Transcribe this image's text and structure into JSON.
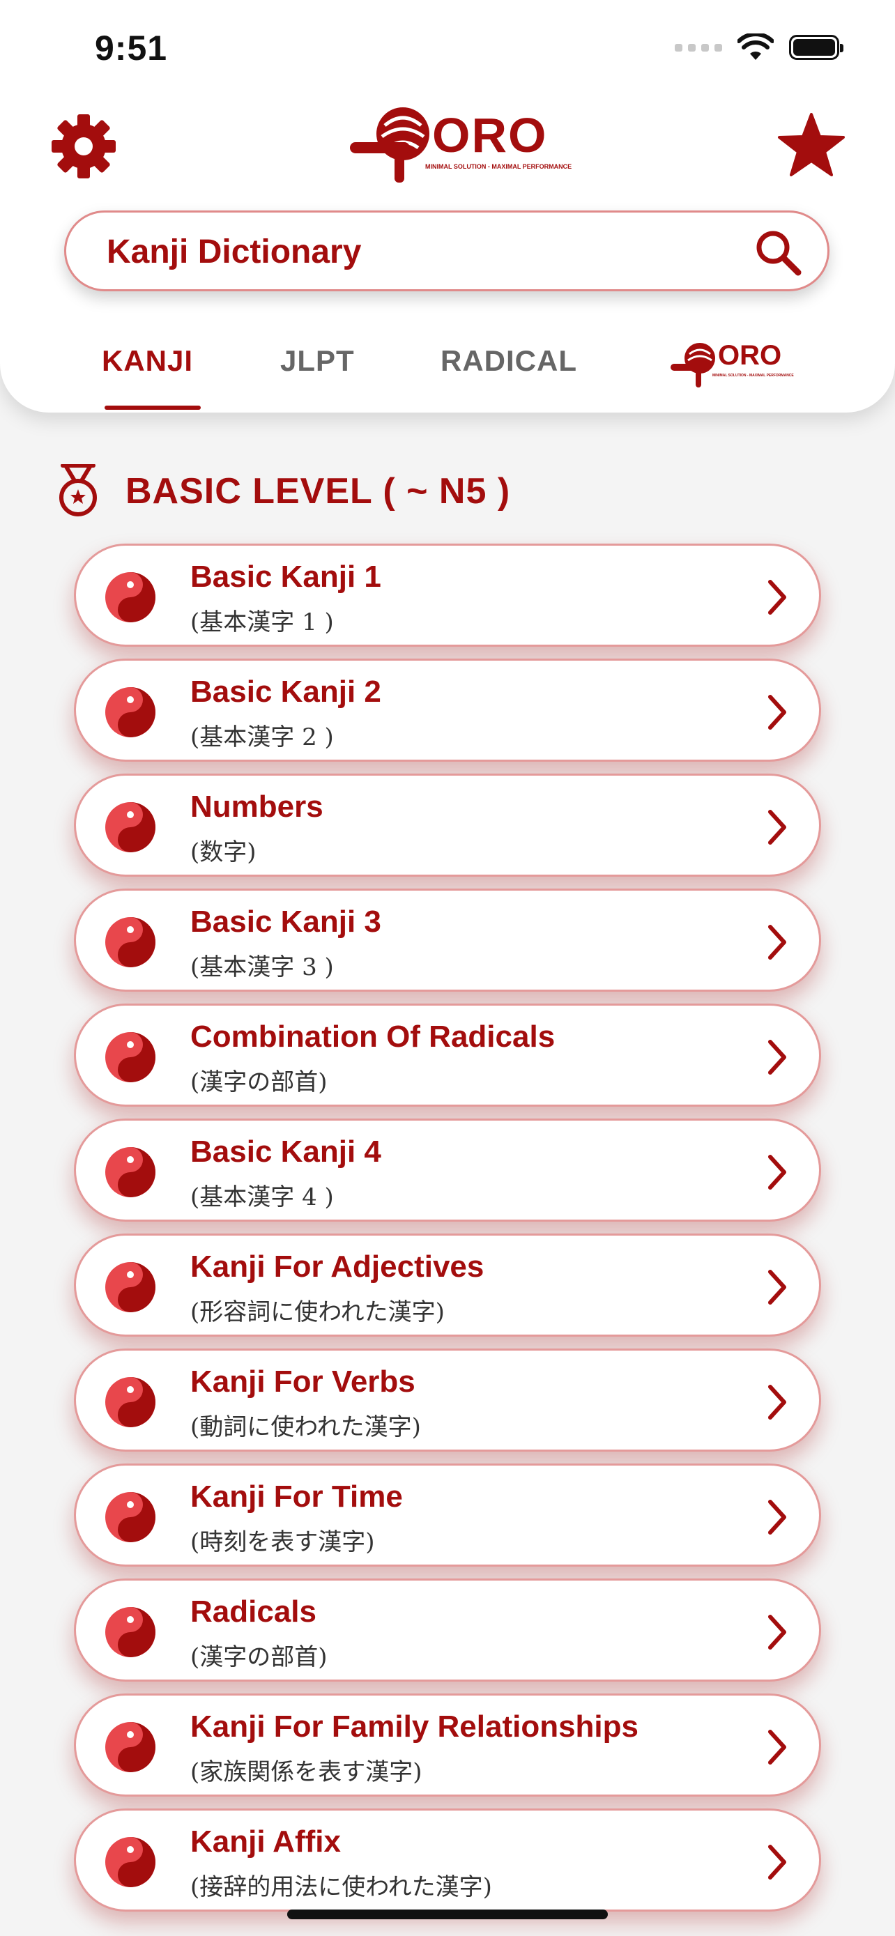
{
  "status": {
    "time": "9:51"
  },
  "brand": {
    "name": "ORO",
    "tagline": "MINIMAL SOLUTION - MAXIMAL PERFORMANCE",
    "color": "#a30d0d"
  },
  "icons": {
    "settings": "gear-icon",
    "favorites": "star-icon",
    "search": "search-icon",
    "section": "medal-icon",
    "item": "yin-yang-icon",
    "chevron": "chevron-right-icon"
  },
  "search": {
    "placeholder": "Kanji Dictionary",
    "value": ""
  },
  "tabs": [
    {
      "label": "KANJI",
      "active": true
    },
    {
      "label": "JLPT",
      "active": false
    },
    {
      "label": "RADICAL",
      "active": false
    }
  ],
  "section": {
    "title": "BASIC LEVEL ( ~ N5 )"
  },
  "items": [
    {
      "title": "Basic Kanji 1",
      "subtitle": "(基本漢字 1 )"
    },
    {
      "title": "Basic Kanji 2",
      "subtitle": "(基本漢字 2 )"
    },
    {
      "title": "Numbers",
      "subtitle": "(数字)"
    },
    {
      "title": "Basic Kanji 3",
      "subtitle": "(基本漢字 3 )"
    },
    {
      "title": "Combination Of Radicals",
      "subtitle": "(漢字の部首)"
    },
    {
      "title": "Basic Kanji 4",
      "subtitle": "(基本漢字 4 )"
    },
    {
      "title": "Kanji For Adjectives",
      "subtitle": "(形容詞に使われた漢字)"
    },
    {
      "title": "Kanji For Verbs",
      "subtitle": "(動詞に使われた漢字)"
    },
    {
      "title": "Kanji For Time",
      "subtitle": "(時刻を表す漢字)"
    },
    {
      "title": "Radicals",
      "subtitle": "(漢字の部首)"
    },
    {
      "title": "Kanji For Family Relationships",
      "subtitle": "(家族関係を表す漢字)"
    },
    {
      "title": "Kanji Affix",
      "subtitle": "(接辞的用法に使われた漢字)"
    }
  ]
}
